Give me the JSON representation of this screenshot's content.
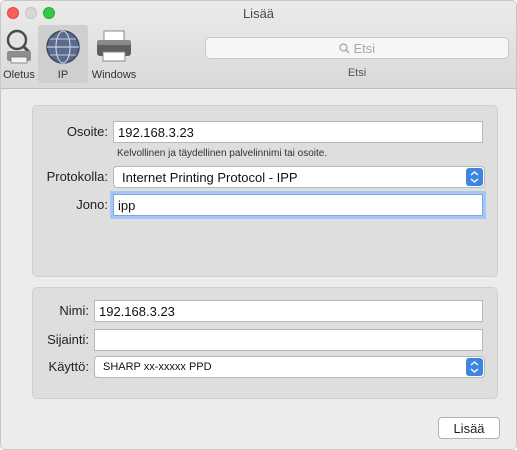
{
  "window": {
    "title": "Lisää"
  },
  "toolbar": {
    "items": [
      {
        "label": "Oletus",
        "icon": "default-printer-icon",
        "selected": false
      },
      {
        "label": "IP",
        "icon": "globe-icon",
        "selected": true
      },
      {
        "label": "Windows",
        "icon": "windows-printer-icon",
        "selected": false
      }
    ],
    "search": {
      "placeholder": "Etsi",
      "caption": "Etsi"
    }
  },
  "connection": {
    "address": {
      "label": "Osoite:",
      "value": "192.168.3.23",
      "hint": "Kelvollinen ja täydellinen palvelinnimi tai osoite."
    },
    "protocol": {
      "label": "Protokolla:",
      "value": "Internet Printing Protocol - IPP"
    },
    "queue": {
      "label": "Jono:",
      "value": "ipp"
    }
  },
  "printer": {
    "name": {
      "label": "Nimi:",
      "value": "192.168.3.23"
    },
    "location": {
      "label": "Sijainti:",
      "value": ""
    },
    "use": {
      "label": "Käyttö:",
      "value": "SHARP xx-xxxxx PPD"
    }
  },
  "actions": {
    "add_label": "Lisää"
  },
  "colors": {
    "accent": "#3d85e0",
    "focus_ring": "#a6c6f5"
  }
}
